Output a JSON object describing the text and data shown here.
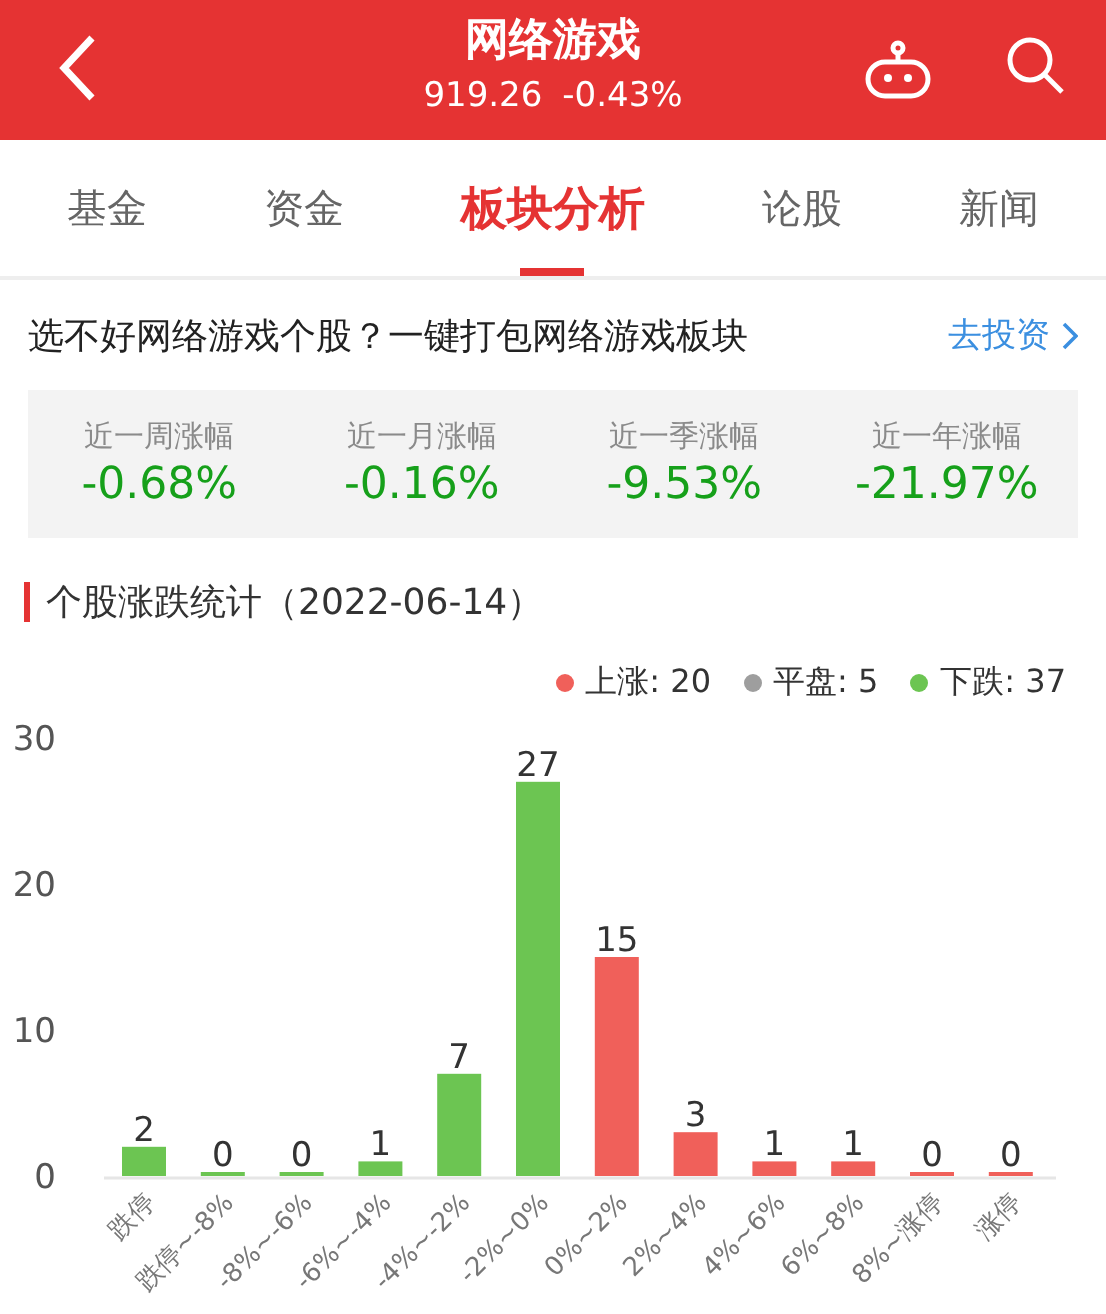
{
  "header": {
    "title": "网络游戏",
    "index_value": "919.26",
    "change": "-0.43%"
  },
  "tabs": [
    {
      "label": "基金",
      "selected": false
    },
    {
      "label": "资金",
      "selected": false
    },
    {
      "label": "板块分析",
      "selected": true
    },
    {
      "label": "论股",
      "selected": false
    },
    {
      "label": "新闻",
      "selected": false
    }
  ],
  "promo": {
    "text": "选不好网络游戏个股？一键打包网络游戏板块",
    "link": "去投资"
  },
  "stats": [
    {
      "label": "近一周涨幅",
      "value": "-0.68%"
    },
    {
      "label": "近一月涨幅",
      "value": "-0.16%"
    },
    {
      "label": "近一季涨幅",
      "value": "-9.53%"
    },
    {
      "label": "近一年涨幅",
      "value": "-21.97%"
    }
  ],
  "section": {
    "title": "个股涨跌统计（2022-06-14）",
    "legend": [
      {
        "label": "上涨: 20",
        "color": "#f0605a"
      },
      {
        "label": "平盘: 5",
        "color": "#9e9e9e"
      },
      {
        "label": "下跌: 37",
        "color": "#6cc552"
      }
    ],
    "chart_data": {
      "type": "bar",
      "categories": [
        "跌停",
        "跌停~-8%",
        "-8%~-6%",
        "-6%~-4%",
        "-4%~-2%",
        "-2%~0%",
        "0%~2%",
        "2%~4%",
        "4%~6%",
        "6%~8%",
        "8%~涨停",
        "涨停"
      ],
      "series": [
        {
          "color": "#6cc552",
          "values": [
            2,
            0,
            0,
            1,
            7,
            27,
            null,
            null,
            null,
            null,
            null,
            null
          ]
        },
        {
          "color": "#f0605a",
          "values": [
            null,
            null,
            null,
            null,
            null,
            null,
            15,
            3,
            1,
            1,
            0,
            0
          ]
        }
      ],
      "stacked": true,
      "ylim": [
        0,
        30
      ],
      "yticks": [
        0,
        10,
        20,
        30
      ],
      "data_labels": true
    }
  }
}
